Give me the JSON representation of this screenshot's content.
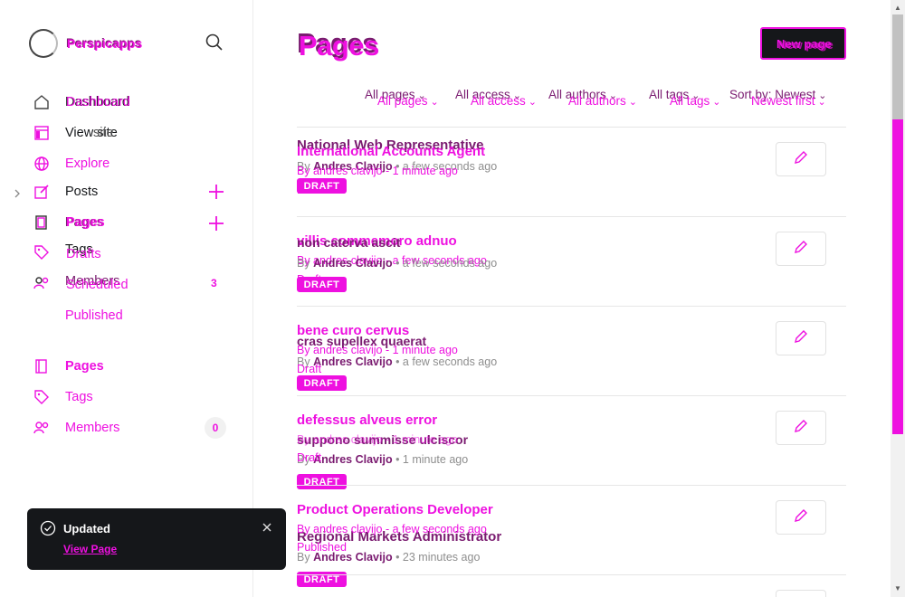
{
  "brand": {
    "name": "Perspicapps",
    "overlay_name": "Perspicapps"
  },
  "nav": {
    "dashboard": "Dashboard",
    "view_site": "View site",
    "explore": "Explore",
    "posts": "Posts",
    "pages": "Pages",
    "tags": "Tags",
    "drafts": "Drafts",
    "members": "Members",
    "scheduled": "Scheduled",
    "published": "Published",
    "members_count": "3",
    "pages2": "Pages",
    "tags2": "Tags",
    "members2": "Members",
    "members2_count": "0"
  },
  "toast": {
    "title": "Updated",
    "link": "View Page"
  },
  "header": {
    "title": "Pages",
    "new_button": "New page"
  },
  "filters": {
    "row1": [
      "All pages",
      "All access",
      "All authors",
      "All tags",
      "Sort by: Newest"
    ],
    "row2": [
      "All pages",
      "All access",
      "All authors",
      "All tags",
      "Newest first"
    ]
  },
  "rows": [
    {
      "title_a": "National Web Representative",
      "title_b": "International Accounts Agent",
      "meta_a_prefix": "By ",
      "meta_a_author": "Andres Clavijo",
      "meta_a_time": " • a few seconds ago",
      "meta_b": "By andres clavijo - 1 minute ago",
      "status": "Draft",
      "badge": "DRAFT"
    },
    {
      "title_a": "villis commemoro adnuo",
      "title_b": "non caterva ascit",
      "meta_a": "By andres clavijo - a few seconds ago",
      "meta_b_prefix": "By ",
      "meta_b_author": "Andres Clavijo",
      "meta_b_time": " • a few seconds ago",
      "status": "Draft",
      "badge": "DRAFT"
    },
    {
      "title_a": "bene curo cervus",
      "title_b": "cras supellex quaerat",
      "meta_a": "By andres clavijo - 1 minute ago",
      "meta_b_prefix": "By ",
      "meta_b_author": "Andres Clavijo",
      "meta_b_time": " • a few seconds ago",
      "status": "Draft",
      "badge": "DRAFT"
    },
    {
      "title_a": "defessus alveus error",
      "title_b": "suppono summisse ulciscor",
      "meta_a": "By andres clavijo - 1 minute ago",
      "meta_b_prefix": "By ",
      "meta_b_author": "Andres Clavijo",
      "meta_b_time": " • 1 minute ago",
      "status": "Draft",
      "badge": "DRAFT"
    },
    {
      "title_a": "Product Operations Developer",
      "title_b": "Regional Markets Administrator",
      "meta_a": "By andres clavijo - a few seconds ago",
      "meta_b_prefix": "By ",
      "meta_b_author": "Andres Clavijo",
      "meta_b_time": " • 23 minutes ago",
      "status": "Published",
      "badge": "DRAFT"
    }
  ],
  "colors": {
    "accent": "#ee10e0",
    "dark_accent": "#7a1b70",
    "text": "#15171a"
  }
}
